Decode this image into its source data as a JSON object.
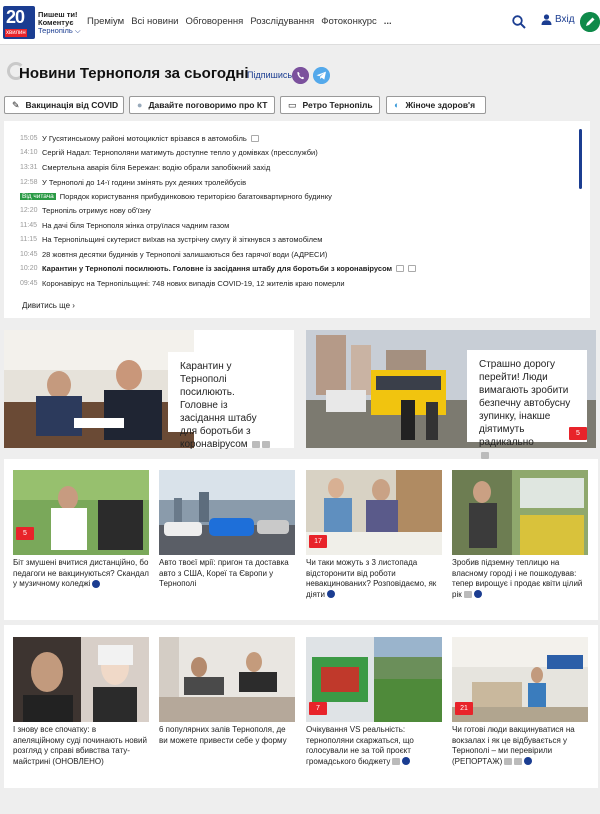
{
  "header": {
    "logo_number": "20",
    "logo_sub": "хвилин",
    "tagline1": "Пишеш ти!",
    "tagline2": "Коментує",
    "city": "Тернопіль ⌵",
    "nav": [
      "Преміум",
      "Всі новини",
      "Обговорення",
      "Розслідування",
      "Фотоконкурс",
      "..."
    ],
    "login": "Вхід"
  },
  "page": {
    "title": "Новини Тернополя за сьогодні",
    "subscribe": "Підпишись"
  },
  "pills": [
    {
      "icon": "✎",
      "label": "Вакцинація від COVID"
    },
    {
      "icon": "●",
      "label": "Давайте поговоримо про КТ"
    },
    {
      "icon": "▭",
      "label": "Ретро Тернопіль"
    },
    {
      "icon": "◐",
      "label": "Жіноче здоров'я"
    }
  ],
  "feed": [
    {
      "time": "15:05",
      "title": "У Гусятинському районі мотоцикліст врізався в автомобіль",
      "cam": true
    },
    {
      "time": "14:10",
      "title": "Сергій Надал: Тернополяни матимуть доступне тепло у домівках (пресслужби)"
    },
    {
      "time": "13:31",
      "title": "Смертельна аварія біля Бережан: водію обрали запобіжний захід"
    },
    {
      "time": "12:58",
      "title": "У Тернополі до 14-ї години змінять рух деяких тролейбусів"
    },
    {
      "badge": "Від читача",
      "title": "Порядок користування прибудинковою територією багатоквартирного будинку"
    },
    {
      "time": "12:20",
      "title": "Тернопіль отримує нову об'їзну"
    },
    {
      "time": "11:45",
      "title": "На дачі біля Тернополя жінка отруїлася чадним газом"
    },
    {
      "time": "11:15",
      "title": "На Тернопільщині скутерист виїхав на зустрічну смугу й зіткнувся з автомобілем"
    },
    {
      "time": "10:45",
      "title": "28 жовтня десятки будинків у Тернополі залишаються без гарячої води (АДРЕСИ)"
    },
    {
      "time": "10:20",
      "title": "Карантин у Тернополі посилюють. Головне із засідання штабу для боротьби з коронавірусом",
      "bold": true,
      "cam": true
    },
    {
      "time": "09:45",
      "title": "Коронавірус на Тернопільщині: 748 нових випадів COVID-19, 12 жителів краю померли"
    }
  ],
  "more": "Дивитись ще  ›",
  "big_cards": [
    {
      "caption": "Карантин у Тернополі посилюють. Головне із засідання штабу для боротьби з коронавірусом"
    },
    {
      "caption": "Страшно дорогу перейти! Люди вимагають зробити безпечну автобусну зупинку, інакше діятимуть радикально",
      "badge": "5"
    }
  ],
  "row1": [
    {
      "caption": "Біт змушені вчитися дистанційно, бо педагоги не вакцинуються? Скандал у музичному коледжі",
      "badge": "5",
      "star": true
    },
    {
      "caption": "Авто твоєї мрії: пригон та доставка авто з США, Корeї та Європи у Тернополі"
    },
    {
      "caption": "Чи таки можуть з 3 листопада відсторонити від роботи невакцинованих? Розповідаємо, як діяти",
      "badge": "17",
      "star": true
    },
    {
      "caption": "Зробив підземну теплицю на власному городі і не пошкодував: тепер вирощує і продає квіти цілий рік",
      "star": true,
      "cam": true
    }
  ],
  "row2": [
    {
      "caption": "І знову все спочатку: в апеляційному суді починають новий розгляд у справі вбивства тату-майстрині (ОНОВЛЕНО)"
    },
    {
      "caption": "6 популярних залів Тернополя, де ви можете привести себе у форму"
    },
    {
      "caption": "Очікування VS реальність: тернополяни скаржаться, що голосували не за той проєкт громадського бюджету",
      "badge": "7",
      "star": true,
      "cam": true
    },
    {
      "caption": "Чи готові люди вакцинуватися на вокзалах і як це відбувається у Тернополі – ми перевірили (РЕПОРТАЖ)",
      "badge": "21",
      "star": true,
      "cam": true
    }
  ]
}
